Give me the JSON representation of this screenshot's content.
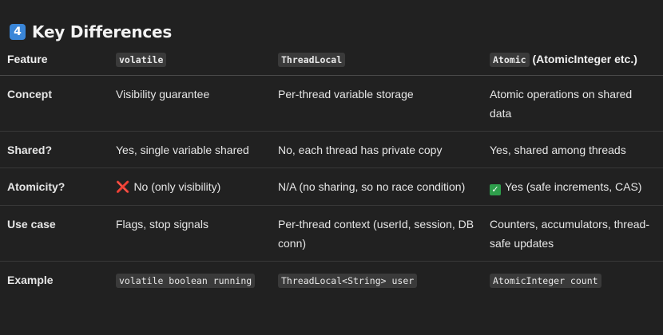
{
  "heading": {
    "icon": "4",
    "icon_name": "keycap-4-icon",
    "title": "Key Differences"
  },
  "table": {
    "headers": {
      "feature": "Feature",
      "volatile_code": "volatile",
      "threadlocal_code": "ThreadLocal",
      "atomic_code": "Atomic",
      "atomic_suffix": "(AtomicInteger etc.)"
    },
    "rows": {
      "concept": {
        "label": "Concept",
        "volatile": "Visibility guarantee",
        "threadlocal": "Per-thread variable storage",
        "atomic": "Atomic operations on shared data"
      },
      "shared": {
        "label": "Shared?",
        "volatile": "Yes, single variable shared",
        "threadlocal": "No, each thread has private copy",
        "atomic": "Yes, shared among threads"
      },
      "atomicity": {
        "label": "Atomicity?",
        "volatile_icon": "❌",
        "volatile": "No (only visibility)",
        "threadlocal": "N/A (no sharing, so no race condition)",
        "atomic_icon": "✓",
        "atomic": "Yes (safe increments, CAS)"
      },
      "usecase": {
        "label": "Use case",
        "volatile": "Flags, stop signals",
        "threadlocal": "Per-thread context (userId, session, DB conn)",
        "atomic": "Counters, accumulators, thread-safe updates"
      },
      "example": {
        "label": "Example",
        "volatile": "volatile boolean running",
        "threadlocal": "ThreadLocal<String> user",
        "atomic": "AtomicInteger count"
      }
    }
  }
}
